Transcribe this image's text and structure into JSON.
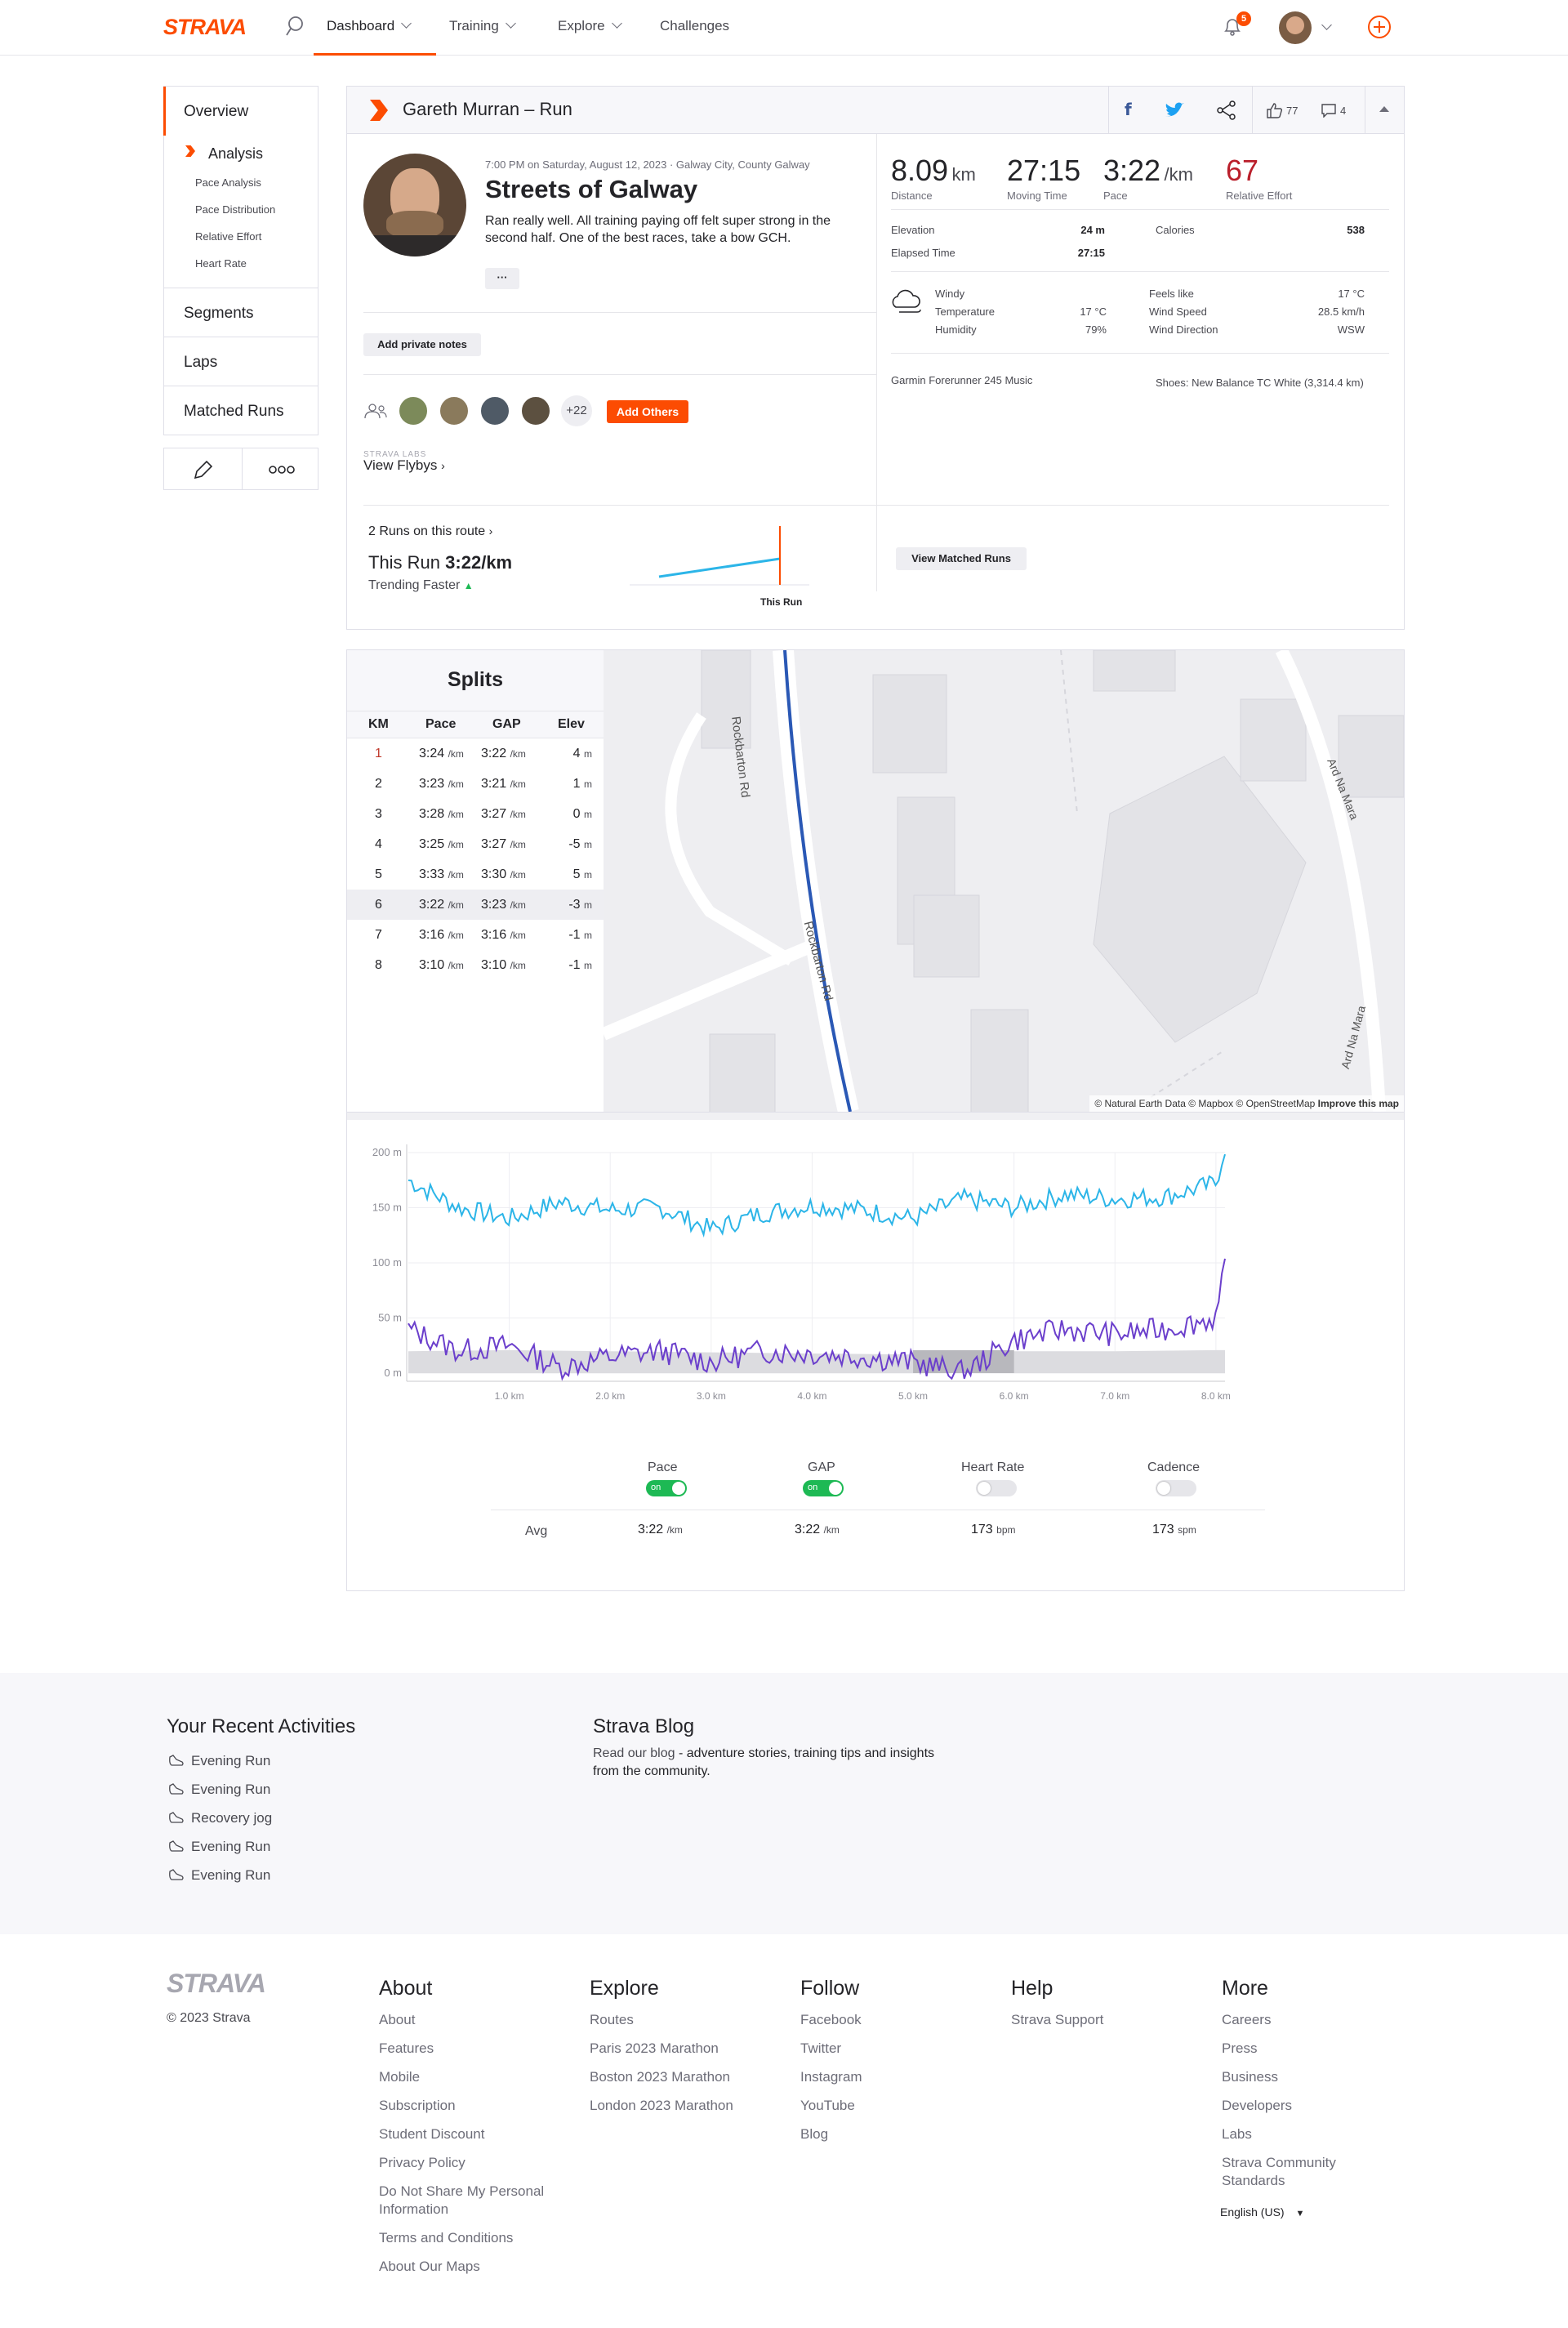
{
  "nav": {
    "logo": "STRAVA",
    "items": [
      "Dashboard",
      "Training",
      "Explore",
      "Challenges"
    ],
    "notif_count": "5"
  },
  "sidebar": {
    "overview": "Overview",
    "analysis": "Analysis",
    "sub": [
      "Pace Analysis",
      "Pace Distribution",
      "Relative Effort",
      "Heart Rate"
    ],
    "segments": "Segments",
    "laps": "Laps",
    "matched": "Matched Runs"
  },
  "header": {
    "title": "Gareth Murran – Run",
    "kudos": "77",
    "comments": "4"
  },
  "activity": {
    "meta": "7:00 PM on Saturday, August 12, 2023 · Galway City, County Galway",
    "name": "Streets of Galway",
    "description": "Ran really well. All training paying off felt super strong in the second half. One of the best races, take a bow GCH.",
    "more": "···",
    "private_notes": "Add private notes",
    "plus_count": "+22",
    "add_others": "Add Others",
    "labs": "STRAVA LABS",
    "flybys": "View Flybys"
  },
  "stats": {
    "distance": "8.09",
    "distance_unit": "km",
    "distance_label": "Distance",
    "moving": "27:15",
    "moving_label": "Moving Time",
    "pace": "3:22",
    "pace_unit": "/km",
    "pace_label": "Pace",
    "effort": "67",
    "effort_label": "Relative Effort",
    "elev_label": "Elevation",
    "elev_val": "24 m",
    "cal_label": "Calories",
    "cal_val": "538",
    "elapsed_label": "Elapsed Time",
    "elapsed_val": "27:15"
  },
  "weather": {
    "condition": "Windy",
    "temp_label": "Temperature",
    "temp": "17 °C",
    "hum_label": "Humidity",
    "hum": "79%",
    "feels_label": "Feels like",
    "feels": "17 °C",
    "wind_label": "Wind Speed",
    "wind": "28.5 km/h",
    "dir_label": "Wind Direction",
    "dir": "WSW"
  },
  "gear": {
    "device": "Garmin Forerunner 245 Music",
    "shoes": "Shoes: New Balance TC White (3,314.4 km)"
  },
  "matched": {
    "runs": "2 Runs on this route",
    "this_run_prefix": "This Run",
    "this_run_pace": "3:22/km",
    "trend": "Trending Faster",
    "chart_label": "This Run",
    "button": "View Matched Runs"
  },
  "splits": {
    "title": "Splits",
    "headers": [
      "KM",
      "Pace",
      "GAP",
      "Elev"
    ],
    "unit_km": "/km",
    "rows": [
      {
        "km": "1",
        "pace": "3:24",
        "gap": "3:22",
        "elev": "4",
        "eu": "m"
      },
      {
        "km": "2",
        "pace": "3:23",
        "gap": "3:21",
        "elev": "1",
        "eu": "m"
      },
      {
        "km": "3",
        "pace": "3:28",
        "gap": "3:27",
        "elev": "0",
        "eu": "m"
      },
      {
        "km": "4",
        "pace": "3:25",
        "gap": "3:27",
        "elev": "-5",
        "eu": "m"
      },
      {
        "km": "5",
        "pace": "3:33",
        "gap": "3:30",
        "elev": "5",
        "eu": "m"
      },
      {
        "km": "6",
        "pace": "3:22",
        "gap": "3:23",
        "elev": "-3",
        "eu": "m"
      },
      {
        "km": "7",
        "pace": "3:16",
        "gap": "3:16",
        "elev": "-1",
        "eu": "m"
      },
      {
        "km": "8",
        "pace": "3:10",
        "gap": "3:10",
        "elev": "-1",
        "eu": "m"
      }
    ]
  },
  "map": {
    "road1": "Rockbarton Rd",
    "road2": "Rockbarton Rd",
    "road3": "Ard Na Mara",
    "road4": "Ard Na Mara",
    "attribution": "© Natural Earth Data © Mapbox © OpenStreetMap",
    "improve": "Improve this map"
  },
  "chart_data": {
    "type": "line",
    "yticks": [
      "200 m",
      "150 m",
      "100 m",
      "50 m",
      "0 m"
    ],
    "xticks": [
      "1.0 km",
      "2.0 km",
      "3.0 km",
      "4.0 km",
      "5.0 km",
      "6.0 km",
      "7.0 km",
      "8.0 km"
    ],
    "ylim": [
      0,
      200
    ],
    "xlim": [
      0,
      8.09
    ],
    "series": [
      {
        "name": "Pace",
        "color": "#2cb5e8",
        "x": [
          0,
          0.5,
          1,
          1.5,
          2,
          2.5,
          3,
          3.5,
          4,
          4.5,
          5,
          5.5,
          6,
          6.5,
          7,
          7.5,
          8,
          8.09
        ],
        "y": [
          175,
          150,
          140,
          155,
          148,
          150,
          130,
          145,
          152,
          148,
          140,
          158,
          150,
          162,
          158,
          160,
          172,
          205
        ]
      },
      {
        "name": "GAP",
        "color": "#6b3fcc",
        "x": [
          0,
          0.5,
          1,
          1.5,
          2,
          2.5,
          3,
          3.5,
          4,
          4.5,
          5,
          5.5,
          6,
          6.5,
          7,
          7.5,
          8,
          8.09
        ],
        "y": [
          40,
          20,
          25,
          5,
          15,
          20,
          10,
          20,
          18,
          15,
          10,
          0,
          30,
          40,
          35,
          40,
          50,
          95
        ]
      },
      {
        "name": "Elevation",
        "color": "#c8c8cc",
        "x": [
          0,
          1,
          2,
          3,
          4,
          5,
          6,
          7,
          8,
          8.09
        ],
        "y": [
          5,
          6,
          5,
          4,
          3,
          2,
          5,
          5,
          6,
          6
        ]
      }
    ]
  },
  "legend": {
    "pace": "Pace",
    "gap": "GAP",
    "hr": "Heart Rate",
    "cad": "Cadence",
    "on": "on",
    "avg": "Avg",
    "pace_avg": "3:22",
    "pace_u": "/km",
    "gap_avg": "3:22",
    "gap_u": "/km",
    "hr_avg": "173",
    "hr_u": "bpm",
    "cad_avg": "173",
    "cad_u": "spm"
  },
  "recent": {
    "title": "Your Recent Activities",
    "items": [
      "Evening Run",
      "Evening Run",
      "Recovery jog",
      "Evening Run",
      "Evening Run"
    ]
  },
  "blog": {
    "title": "Strava Blog",
    "pre": "Read our blog",
    "text": " - adventure stories, training tips and insights from the community."
  },
  "footer": {
    "logo": "STRAVA",
    "copyright": "© 2023 Strava",
    "about": {
      "title": "About",
      "links": [
        "About",
        "Features",
        "Mobile",
        "Subscription",
        "Student Discount",
        "Privacy Policy",
        "Do Not Share My Personal Information",
        "Terms and Conditions",
        "About Our Maps"
      ]
    },
    "explore": {
      "title": "Explore",
      "links": [
        "Routes",
        "Paris 2023 Marathon",
        "Boston 2023 Marathon",
        "London 2023 Marathon"
      ]
    },
    "follow": {
      "title": "Follow",
      "links": [
        "Facebook",
        "Twitter",
        "Instagram",
        "YouTube",
        "Blog"
      ]
    },
    "help": {
      "title": "Help",
      "links": [
        "Strava Support"
      ]
    },
    "more": {
      "title": "More",
      "links": [
        "Careers",
        "Press",
        "Business",
        "Developers",
        "Labs",
        "Strava Community Standards"
      ]
    },
    "lang": "English (US)"
  }
}
